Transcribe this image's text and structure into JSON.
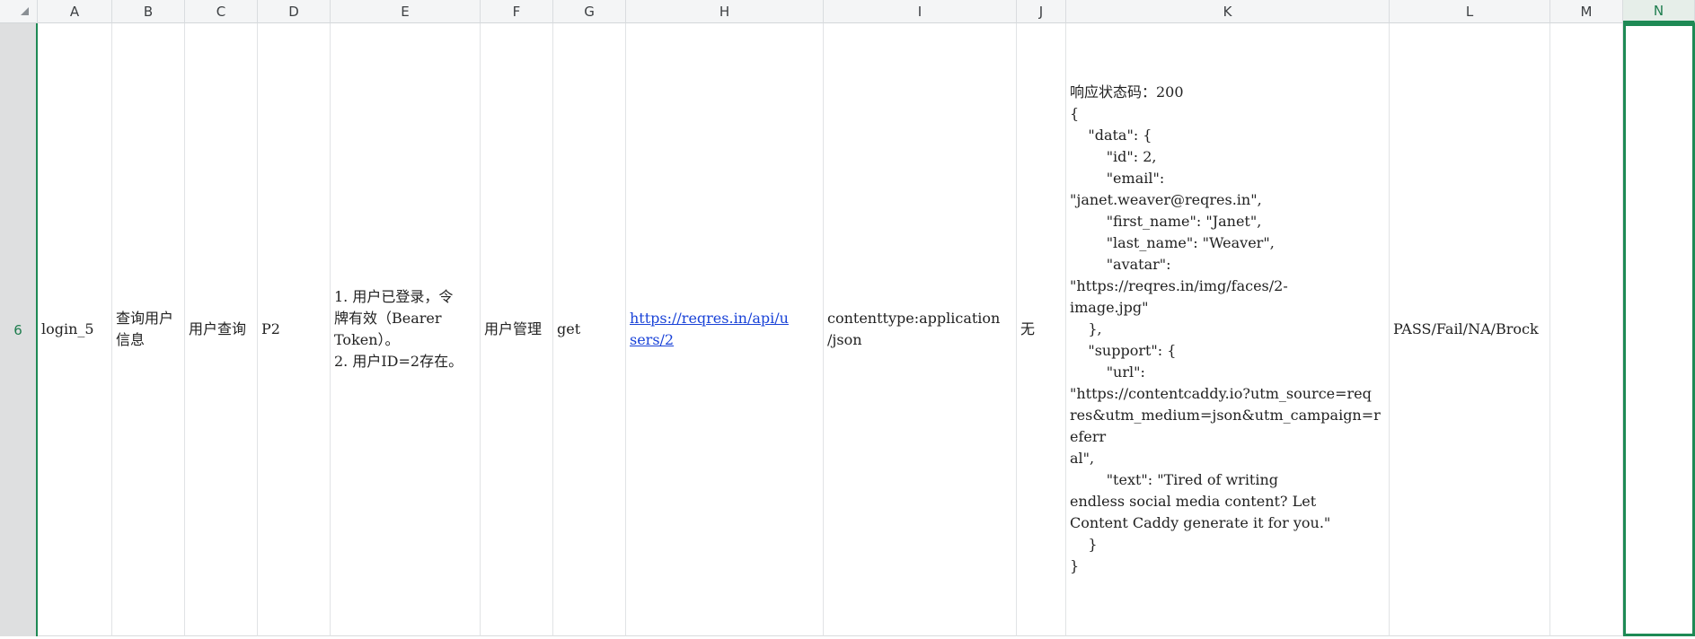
{
  "sheet": {
    "columns": [
      "A",
      "B",
      "C",
      "D",
      "E",
      "F",
      "G",
      "H",
      "I",
      "J",
      "K",
      "L",
      "M",
      "N"
    ],
    "active_column": "N",
    "row_number": "6",
    "cells": {
      "A": "login_5",
      "B": "查询用户\n信息",
      "C": "用户查询",
      "D": "P2",
      "E": "1. 用户已登录，令\n牌有效（Bearer\nToken）。\n2. 用户ID=2存在。",
      "F": "用户管理",
      "G": "get",
      "H": "https://reqres.in/api/u\nsers/2",
      "I": "contenttype:application\n/json",
      "J": "无",
      "K": "响应状态码：200\n{\n    \"data\": {\n        \"id\": 2,\n        \"email\":\n\"janet.weaver@reqres.in\",\n        \"first_name\": \"Janet\",\n        \"last_name\": \"Weaver\",\n        \"avatar\":\n\"https://reqres.in/img/faces/2-\nimage.jpg\"\n    },\n    \"support\": {\n        \"url\":\n\"https://contentcaddy.io?utm_source=req\nres&utm_medium=json&utm_campaign=referr\nal\",\n        \"text\": \"Tired of writing\nendless social media content? Let\nContent Caddy generate it for you.\"\n    }\n}",
      "L": "PASS/Fail/NA/Brock",
      "M": "",
      "N": ""
    }
  }
}
